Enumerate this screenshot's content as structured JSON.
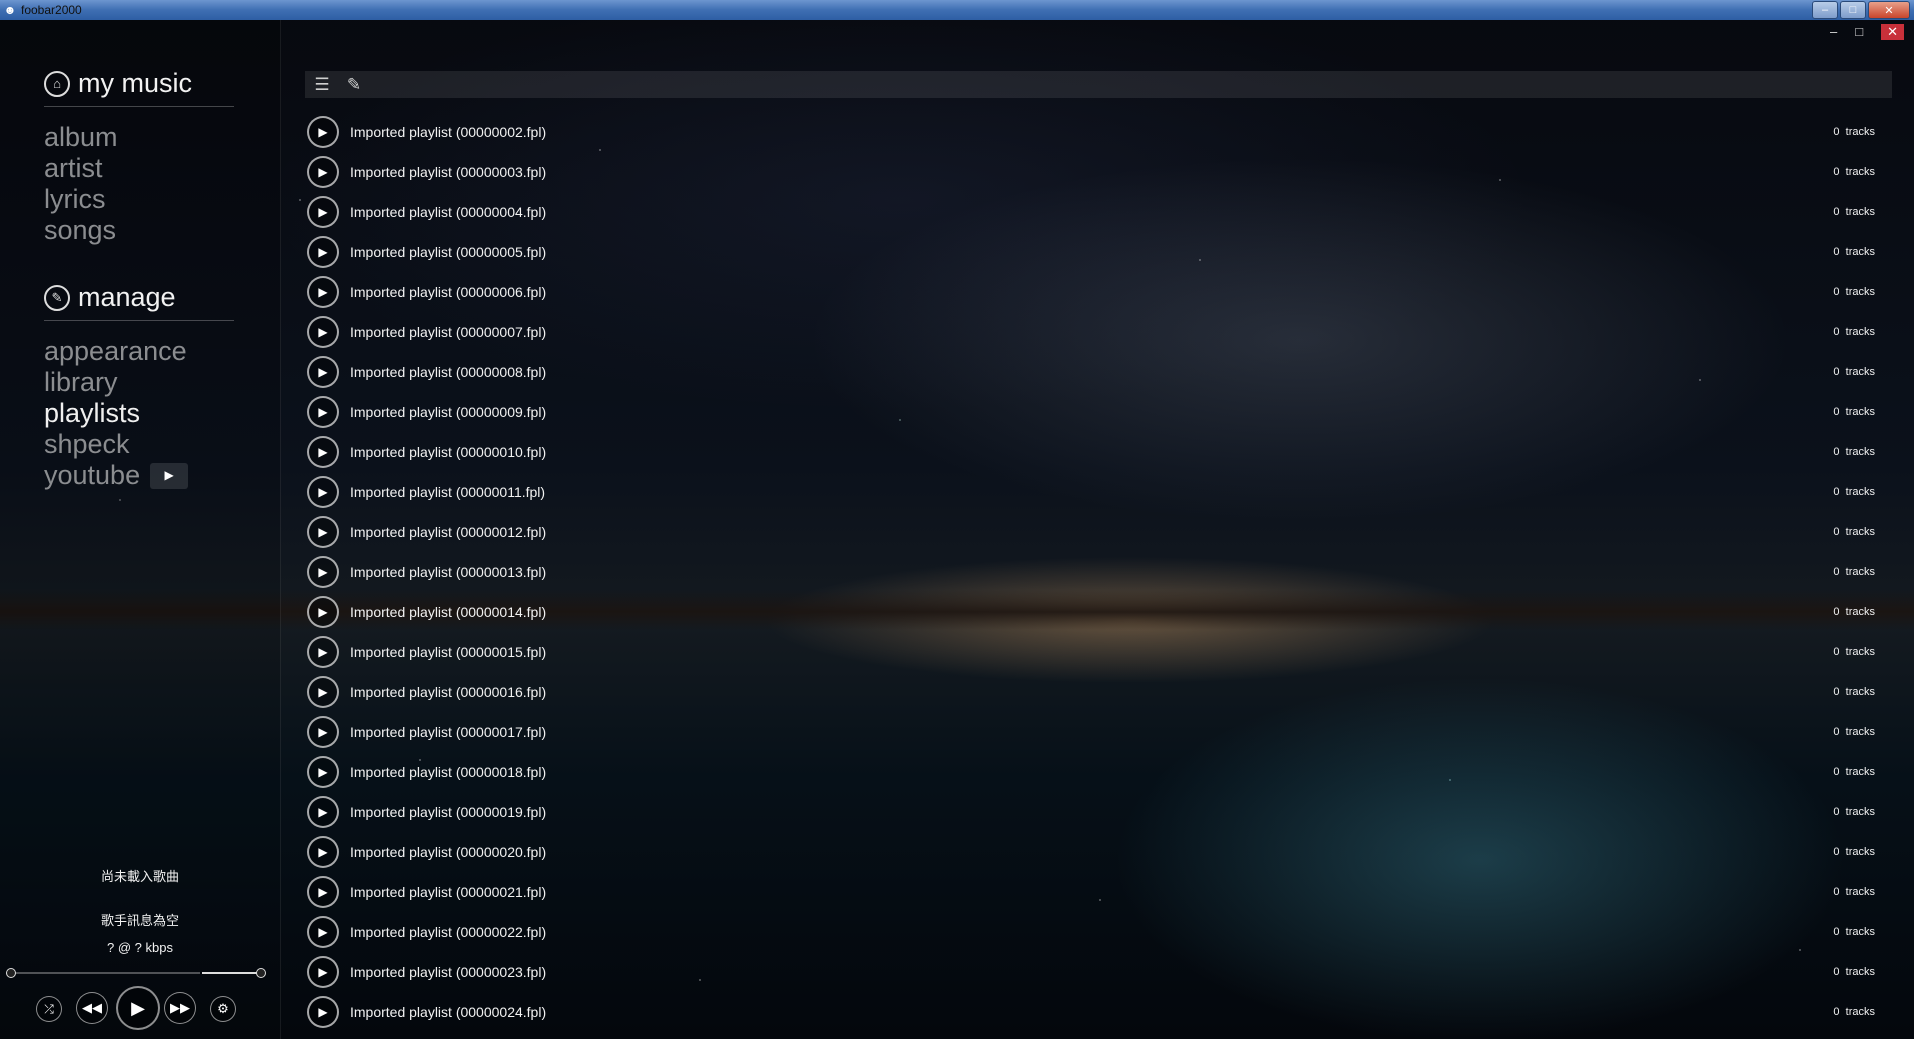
{
  "window": {
    "title": "foobar2000",
    "app_icon": "foobar-icon",
    "controls": {
      "minimize": "–",
      "maximize": "□",
      "close": "✕"
    }
  },
  "inner_controls": {
    "minimize": "–",
    "maximize": "□",
    "close": "✕"
  },
  "sidebar": {
    "my_music": {
      "title": "my music",
      "icon": "home-icon",
      "items": [
        "album",
        "artist",
        "lyrics",
        "songs"
      ]
    },
    "manage": {
      "title": "manage",
      "icon": "edit-icon",
      "items": [
        "appearance",
        "library",
        "playlists",
        "shpeck",
        "youtube"
      ],
      "active": "playlists"
    }
  },
  "now_playing": {
    "track": "尚未載入歌曲",
    "artist": "歌手訊息為空",
    "bitrate": "? @ ? kbps"
  },
  "playlists": [
    {
      "name": "Imported playlist (00000002.fpl)",
      "count": "0",
      "unit": "tracks"
    },
    {
      "name": "Imported playlist (00000003.fpl)",
      "count": "0",
      "unit": "tracks"
    },
    {
      "name": "Imported playlist (00000004.fpl)",
      "count": "0",
      "unit": "tracks"
    },
    {
      "name": "Imported playlist (00000005.fpl)",
      "count": "0",
      "unit": "tracks"
    },
    {
      "name": "Imported playlist (00000006.fpl)",
      "count": "0",
      "unit": "tracks"
    },
    {
      "name": "Imported playlist (00000007.fpl)",
      "count": "0",
      "unit": "tracks"
    },
    {
      "name": "Imported playlist (00000008.fpl)",
      "count": "0",
      "unit": "tracks"
    },
    {
      "name": "Imported playlist (00000009.fpl)",
      "count": "0",
      "unit": "tracks"
    },
    {
      "name": "Imported playlist (00000010.fpl)",
      "count": "0",
      "unit": "tracks"
    },
    {
      "name": "Imported playlist (00000011.fpl)",
      "count": "0",
      "unit": "tracks"
    },
    {
      "name": "Imported playlist (00000012.fpl)",
      "count": "0",
      "unit": "tracks"
    },
    {
      "name": "Imported playlist (00000013.fpl)",
      "count": "0",
      "unit": "tracks"
    },
    {
      "name": "Imported playlist (00000014.fpl)",
      "count": "0",
      "unit": "tracks"
    },
    {
      "name": "Imported playlist (00000015.fpl)",
      "count": "0",
      "unit": "tracks"
    },
    {
      "name": "Imported playlist (00000016.fpl)",
      "count": "0",
      "unit": "tracks"
    },
    {
      "name": "Imported playlist (00000017.fpl)",
      "count": "0",
      "unit": "tracks"
    },
    {
      "name": "Imported playlist (00000018.fpl)",
      "count": "0",
      "unit": "tracks"
    },
    {
      "name": "Imported playlist (00000019.fpl)",
      "count": "0",
      "unit": "tracks"
    },
    {
      "name": "Imported playlist (00000020.fpl)",
      "count": "0",
      "unit": "tracks"
    },
    {
      "name": "Imported playlist (00000021.fpl)",
      "count": "0",
      "unit": "tracks"
    },
    {
      "name": "Imported playlist (00000022.fpl)",
      "count": "0",
      "unit": "tracks"
    },
    {
      "name": "Imported playlist (00000023.fpl)",
      "count": "0",
      "unit": "tracks"
    },
    {
      "name": "Imported playlist (00000024.fpl)",
      "count": "0",
      "unit": "tracks"
    }
  ],
  "colors": {
    "accent": "#ffffff",
    "muted_nav": "#8b8d90",
    "titlebar": "#3f6fb3",
    "close": "#c8303a"
  }
}
